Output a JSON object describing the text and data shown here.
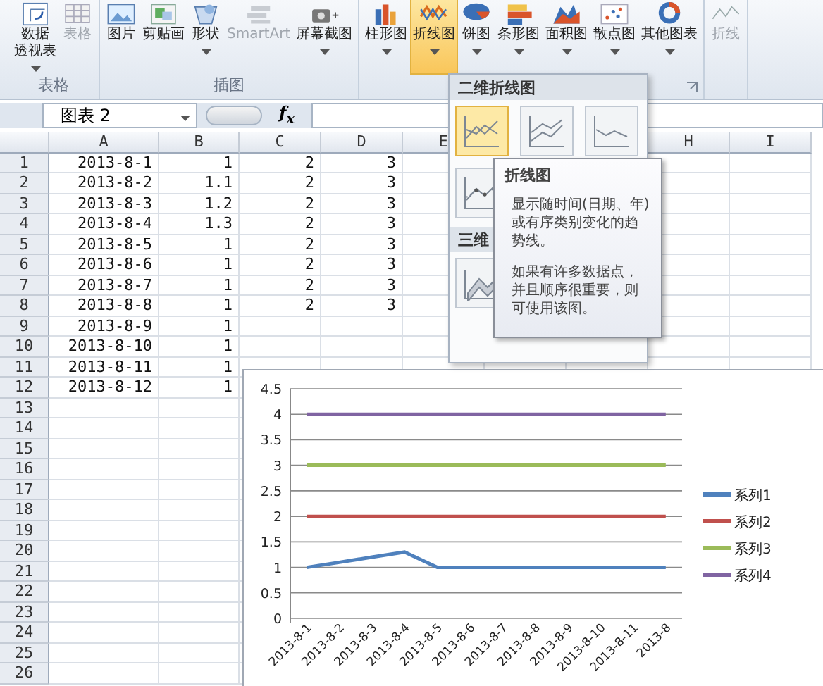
{
  "ribbon": {
    "groups": [
      {
        "label": "表格",
        "buttons": [
          {
            "lines": [
              "数据",
              "透视表"
            ],
            "menu": true,
            "disabled": false,
            "selected": false
          },
          {
            "lines": [
              "表格"
            ],
            "menu": false,
            "disabled": true,
            "selected": false
          }
        ]
      },
      {
        "label": "插图",
        "buttons": [
          {
            "lines": [
              "图片"
            ],
            "menu": false,
            "disabled": false,
            "selected": false
          },
          {
            "lines": [
              "剪贴画"
            ],
            "menu": false,
            "disabled": false,
            "selected": false
          },
          {
            "lines": [
              "形状"
            ],
            "menu": true,
            "disabled": false,
            "selected": false
          },
          {
            "lines": [
              "SmartArt"
            ],
            "menu": false,
            "disabled": true,
            "selected": false
          },
          {
            "lines": [
              "屏幕截图"
            ],
            "menu": true,
            "disabled": false,
            "selected": false
          }
        ]
      },
      {
        "buttons": [
          {
            "lines": [
              "柱形图"
            ],
            "menu": true,
            "disabled": false,
            "selected": false
          },
          {
            "lines": [
              "折线图"
            ],
            "menu": true,
            "disabled": false,
            "selected": true
          },
          {
            "lines": [
              "饼图"
            ],
            "menu": true,
            "disabled": false,
            "selected": false
          },
          {
            "lines": [
              "条形图"
            ],
            "menu": true,
            "disabled": false,
            "selected": false
          },
          {
            "lines": [
              "面积图"
            ],
            "menu": true,
            "disabled": false,
            "selected": false
          },
          {
            "lines": [
              "散点图"
            ],
            "menu": true,
            "disabled": false,
            "selected": false
          },
          {
            "lines": [
              "其他图表"
            ],
            "menu": true,
            "disabled": false,
            "selected": false
          }
        ]
      },
      {
        "buttons": [
          {
            "lines": [
              "折线"
            ],
            "menu": false,
            "disabled": true,
            "selected": false
          }
        ]
      }
    ]
  },
  "formula_bar": {
    "name_box": "图表 2",
    "fx": "f$_{x}$"
  },
  "sheet": {
    "columns": [
      "A",
      "B",
      "C",
      "D",
      "E",
      "H",
      "I"
    ],
    "rows": [
      {
        "header": "1",
        "cells": [
          "2013-8-1",
          "1",
          "2",
          "3"
        ]
      },
      {
        "header": "2",
        "cells": [
          "2013-8-2",
          "1.1",
          "2",
          "3"
        ]
      },
      {
        "header": "3",
        "cells": [
          "2013-8-3",
          "1.2",
          "2",
          "3"
        ]
      },
      {
        "header": "4",
        "cells": [
          "2013-8-4",
          "1.3",
          "2",
          "3"
        ]
      },
      {
        "header": "5",
        "cells": [
          "2013-8-5",
          "1",
          "2",
          "3"
        ]
      },
      {
        "header": "6",
        "cells": [
          "2013-8-6",
          "1",
          "2",
          "3"
        ]
      },
      {
        "header": "7",
        "cells": [
          "2013-8-7",
          "1",
          "2",
          "3"
        ]
      },
      {
        "header": "8",
        "cells": [
          "2013-8-8",
          "1",
          "2",
          "3"
        ]
      },
      {
        "header": "9",
        "cells": [
          "2013-8-9",
          "1"
        ]
      },
      {
        "header": "10",
        "cells": [
          "2013-8-10",
          "1"
        ]
      },
      {
        "header": "11",
        "cells": [
          "2013-8-11",
          "1"
        ]
      },
      {
        "header": "12",
        "cells": [
          "2013-8-12",
          "1"
        ]
      },
      {
        "header": "13"
      },
      {
        "header": "14"
      },
      {
        "header": "15"
      },
      {
        "header": "16"
      },
      {
        "header": "17"
      },
      {
        "header": "18"
      },
      {
        "header": "19"
      },
      {
        "header": "20"
      },
      {
        "header": "21"
      },
      {
        "header": "22"
      },
      {
        "header": "23"
      },
      {
        "header": "24"
      },
      {
        "header": "25"
      },
      {
        "header": "26"
      }
    ]
  },
  "chart": {
    "chart_data": {
      "type": "line",
      "grid": true,
      "legend": "right",
      "categories": [
        "2013-8-1",
        "2013-8-2",
        "2013-8-3",
        "2013-8-4",
        "2013-8-5",
        "2013-8-6",
        "2013-8-7",
        "2013-8-8",
        "2013-8-9",
        "2013-8-10",
        "2013-8-11",
        "2013-8"
      ],
      "ylim": [
        0,
        4.5
      ],
      "yticks": [
        0,
        0.5,
        1,
        1.5,
        2,
        2.5,
        3,
        3.5,
        4,
        4.5
      ],
      "series": [
        {
          "name": "系列1",
          "color": "#4f81bd",
          "values": [
            1,
            1.1,
            1.2,
            1.3,
            1,
            1,
            1,
            1,
            1,
            1,
            1,
            1
          ]
        },
        {
          "name": "系列2",
          "color": "#c0504d",
          "values": [
            2,
            2,
            2,
            2,
            2,
            2,
            2,
            2,
            2,
            2,
            2,
            2
          ]
        },
        {
          "name": "系列3",
          "color": "#9bbb59",
          "values": [
            3,
            3,
            3,
            3,
            3,
            3,
            3,
            3,
            3,
            3,
            3,
            3
          ]
        },
        {
          "name": "系列4",
          "color": "#8064a2",
          "values": [
            4,
            4,
            4,
            4,
            4,
            4,
            4,
            4,
            4,
            4,
            4,
            4
          ]
        }
      ]
    }
  },
  "dropdown": {
    "sections": [
      {
        "title": "二维折线图",
        "icons": [
          {
            "selected": true
          },
          {
            "selected": false
          },
          {
            "selected": false
          },
          {
            "selected": false
          }
        ]
      },
      {
        "title": "三维",
        "icons": [
          {
            "selected": false
          }
        ]
      }
    ]
  },
  "tooltip": {
    "title": "折线图",
    "paragraphs": [
      "显示随时间(日期、年)或有序类别变化的趋势线。",
      "如果有许多数据点，并且顺序很重要，则可使用该图。"
    ]
  }
}
